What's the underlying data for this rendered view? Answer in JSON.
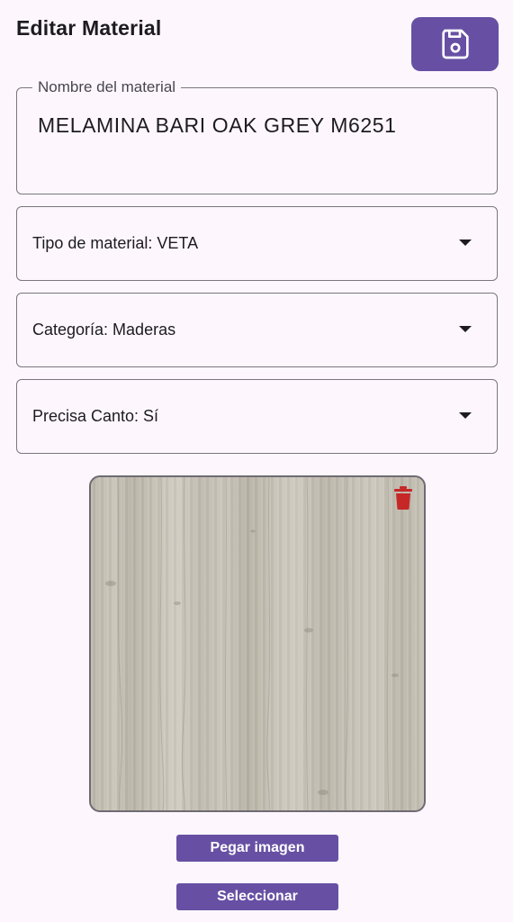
{
  "header": {
    "title": "Editar Material",
    "save_icon": "save-floppy-icon",
    "accent_color": "#6750a4"
  },
  "form": {
    "name_field": {
      "label": "Nombre del material",
      "value": "MELAMINA BARI OAK GREY M6251"
    },
    "dropdowns": [
      {
        "label": "Tipo de material: VETA"
      },
      {
        "label": "Categoría: Maderas"
      },
      {
        "label": "Precisa Canto: Sí"
      }
    ]
  },
  "image": {
    "delete_icon": "trash-icon",
    "delete_color": "#c62828"
  },
  "actions": {
    "paste_label": "Pegar imagen",
    "select_label": "Seleccionar"
  }
}
